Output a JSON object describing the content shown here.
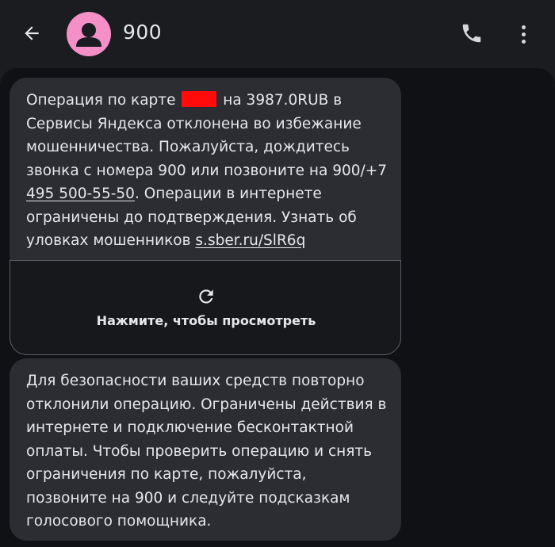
{
  "header": {
    "title": "900",
    "back_icon": "arrow-left-icon",
    "avatar_icon": "person-icon",
    "call_icon": "phone-icon",
    "menu_icon": "more-vertical-icon",
    "avatar_color": "#f48fc8"
  },
  "messages": [
    {
      "text_part1": "Операция по карте",
      "text_part2": "на 3987.0RUB в Сервисы Яндекса отклонена во избежание мошенничества. Пожалуйста, дождитесь звонка с номера 900 или позвоните на 900/+7",
      "phone_link": "495 500-55-50",
      "text_part3": ". Операции в интернете ограничены до подтверждения. Узнать об уловках мошенников",
      "url_link": "s.sber.ru/SlR6q",
      "preview_label": "Нажмите, чтобы просмотреть",
      "preview_icon": "reload-icon"
    },
    {
      "text": "Для безопасности ваших средств повторно отклонили операцию. Ограничены действия в интернете и подключение бесконтактной оплаты. Чтобы проверить операцию и снять ограничения по карте, пожалуйста, позвоните на 900 и следуйте подсказкам голосового помощника."
    }
  ]
}
